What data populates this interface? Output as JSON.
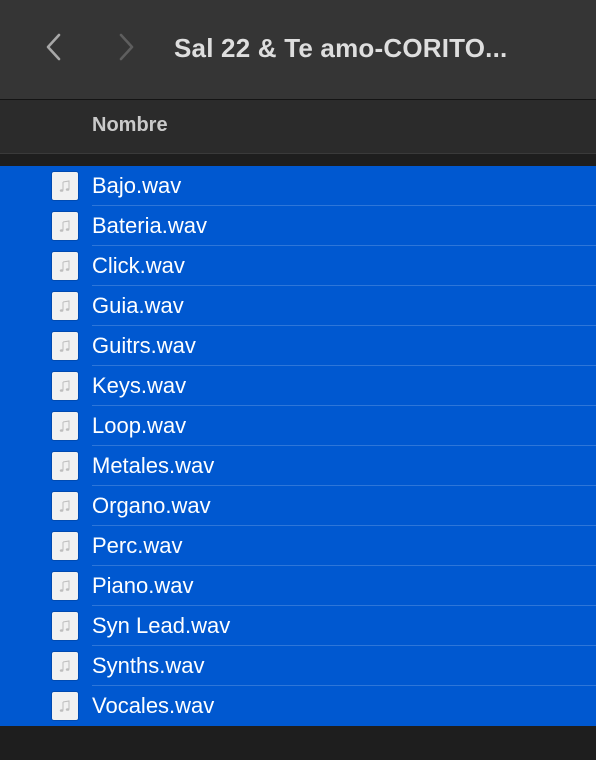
{
  "window": {
    "title": "Sal 22 & Te amo-CORITO..."
  },
  "nav": {
    "back_icon": "chevron-left-icon",
    "forward_icon": "chevron-right-icon"
  },
  "header": {
    "column_name": "Nombre"
  },
  "files": [
    {
      "name": "Bajo.wav",
      "icon": "audio-file-icon"
    },
    {
      "name": "Bateria.wav",
      "icon": "audio-file-icon"
    },
    {
      "name": "Click.wav",
      "icon": "audio-file-icon"
    },
    {
      "name": "Guia.wav",
      "icon": "audio-file-icon"
    },
    {
      "name": "Guitrs.wav",
      "icon": "audio-file-icon"
    },
    {
      "name": "Keys.wav",
      "icon": "audio-file-icon"
    },
    {
      "name": "Loop.wav",
      "icon": "audio-file-icon"
    },
    {
      "name": "Metales.wav",
      "icon": "audio-file-icon"
    },
    {
      "name": "Organo.wav",
      "icon": "audio-file-icon"
    },
    {
      "name": "Perc.wav",
      "icon": "audio-file-icon"
    },
    {
      "name": "Piano.wav",
      "icon": "audio-file-icon"
    },
    {
      "name": "Syn Lead.wav",
      "icon": "audio-file-icon"
    },
    {
      "name": "Synths.wav",
      "icon": "audio-file-icon"
    },
    {
      "name": "Vocales.wav",
      "icon": "audio-file-icon"
    }
  ],
  "colors": {
    "selection": "#0058d0",
    "toolbar": "#353535",
    "header": "#2b2b2b",
    "background": "#1e1e1e"
  }
}
